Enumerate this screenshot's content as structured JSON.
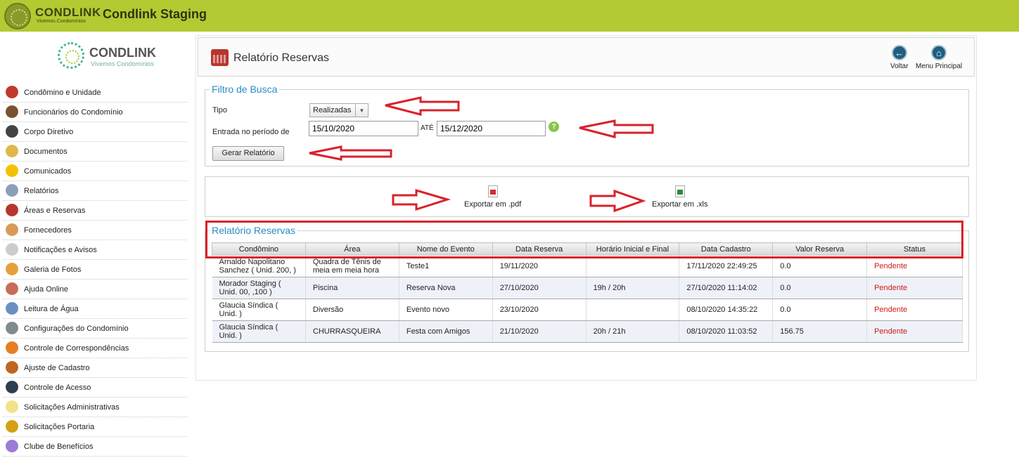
{
  "topbar": {
    "brand": "CONDLINK",
    "tagline": "Vivemos Condomínios",
    "title": "Condlink Staging"
  },
  "sidebar": {
    "logo_text": "CONDLINK",
    "logo_sub": "Vivemos Condomínios",
    "items": [
      {
        "label": "Condômino e Unidade",
        "icon": "people-icon",
        "color": "#c0392b"
      },
      {
        "label": "Funcionários do Condomínio",
        "icon": "workers-icon",
        "color": "#7a5230"
      },
      {
        "label": "Corpo Diretivo",
        "icon": "director-icon",
        "color": "#444"
      },
      {
        "label": "Documentos",
        "icon": "folder-icon",
        "color": "#e0b84a"
      },
      {
        "label": "Comunicados",
        "icon": "warning-icon",
        "color": "#f2c200"
      },
      {
        "label": "Relatórios",
        "icon": "report-icon",
        "color": "#8aa0b8"
      },
      {
        "label": "Áreas e Reservas",
        "icon": "calendar-icon",
        "color": "#b8352e"
      },
      {
        "label": "Fornecedores",
        "icon": "handshake-icon",
        "color": "#d99a5b"
      },
      {
        "label": "Notificações e Avisos",
        "icon": "bell-icon",
        "color": "#cccccc"
      },
      {
        "label": "Galeria de Fotos",
        "icon": "photos-icon",
        "color": "#e6a03c"
      },
      {
        "label": "Ajuda Online",
        "icon": "help-people-icon",
        "color": "#c86b5a"
      },
      {
        "label": "Leitura de Água",
        "icon": "faucet-icon",
        "color": "#6a8fc0"
      },
      {
        "label": "Configurações do Condomínio",
        "icon": "buildings-icon",
        "color": "#7f8c8d"
      },
      {
        "label": "Controle de Correspondências",
        "icon": "mail-icon",
        "color": "#e67e22"
      },
      {
        "label": "Ajuste de Cadastro",
        "icon": "wallet-icon",
        "color": "#c0641e"
      },
      {
        "label": "Controle de Acesso",
        "icon": "camera-icon",
        "color": "#2c3e50"
      },
      {
        "label": "Solicitações Administrativas",
        "icon": "note-icon",
        "color": "#f1e28a"
      },
      {
        "label": "Solicitações Portaria",
        "icon": "hammer-icon",
        "color": "#d4a017"
      },
      {
        "label": "Clube de Benefícios",
        "icon": "globe-icon",
        "color": "#9b7ad8"
      }
    ]
  },
  "header": {
    "title": "Relatório Reservas",
    "back_label": "Voltar",
    "home_label": "Menu Principal"
  },
  "filter": {
    "legend": "Filtro de Busca",
    "tipo_label": "Tipo",
    "tipo_value": "Realizadas",
    "periodo_label": "Entrada no período de",
    "date_from": "15/10/2020",
    "ate_label": "ATÉ",
    "date_to": "15/12/2020",
    "generate_label": "Gerar Relatório"
  },
  "export": {
    "pdf_label": "Exportar em .pdf",
    "xls_label": "Exportar em .xls"
  },
  "report": {
    "legend": "Relatório Reservas",
    "columns": [
      "Condômino",
      "Área",
      "Nome do Evento",
      "Data Reserva",
      "Horário Inicial e Final",
      "Data Cadastro",
      "Valor Reserva",
      "Status"
    ],
    "rows": [
      [
        "Arnaldo Napolitano Sanchez ( Unid. 200, )",
        "Quadra de Tênis de meia em meia hora",
        "Teste1",
        "19/11/2020",
        "",
        "17/11/2020 22:49:25",
        "0.0",
        "Pendente"
      ],
      [
        "Morador Staging ( Unid. 00, ,100 )",
        "Piscina",
        "Reserva Nova",
        "27/10/2020",
        "19h / 20h",
        "27/10/2020 11:14:02",
        "0.0",
        "Pendente"
      ],
      [
        "Glaucia Síndica ( Unid. )",
        "Diversão",
        "Evento novo",
        "23/10/2020",
        "",
        "08/10/2020 14:35:22",
        "0.0",
        "Pendente"
      ],
      [
        "Glaucia Síndica ( Unid. )",
        "CHURRASQUEIRA",
        "Festa com Amigos",
        "21/10/2020",
        "20h / 21h",
        "08/10/2020 11:03:52",
        "156.75",
        "Pendente"
      ]
    ]
  },
  "colors": {
    "topbar": "#b5c932",
    "accent": "#2a8cc0",
    "annotation": "#d8222a",
    "status_pending": "#d01818"
  }
}
